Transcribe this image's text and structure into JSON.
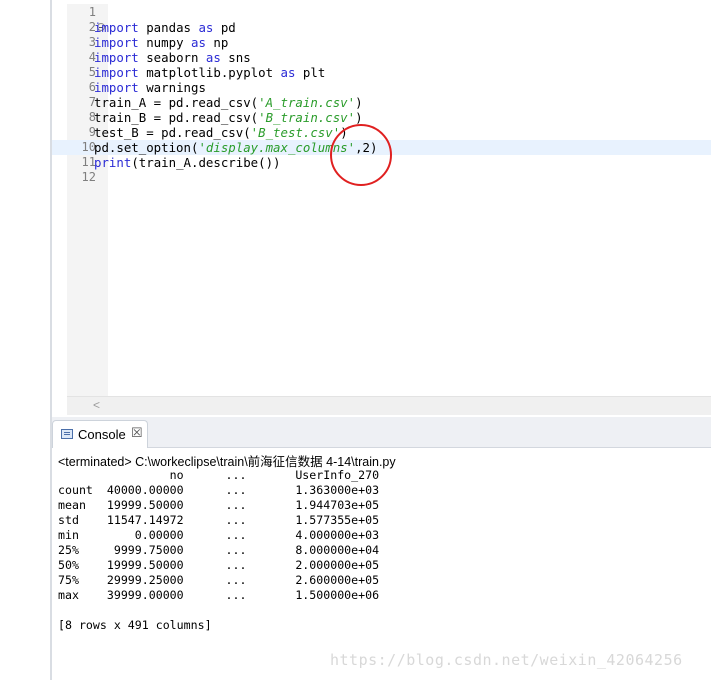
{
  "editor": {
    "lines": [
      {
        "n": "1",
        "tokens": []
      },
      {
        "n": "2",
        "fold": true,
        "tokens": [
          {
            "t": "import",
            "c": "kw"
          },
          {
            "t": " pandas "
          },
          {
            "t": "as",
            "c": "kw"
          },
          {
            "t": " pd"
          }
        ]
      },
      {
        "n": "3",
        "tokens": [
          {
            "t": "import",
            "c": "kw"
          },
          {
            "t": " numpy "
          },
          {
            "t": "as",
            "c": "kw"
          },
          {
            "t": " np"
          }
        ]
      },
      {
        "n": "4",
        "tokens": [
          {
            "t": "import",
            "c": "kw"
          },
          {
            "t": " seaborn "
          },
          {
            "t": "as",
            "c": "kw"
          },
          {
            "t": " sns"
          }
        ]
      },
      {
        "n": "5",
        "tokens": [
          {
            "t": "import",
            "c": "kw"
          },
          {
            "t": " matplotlib.pyplot "
          },
          {
            "t": "as",
            "c": "kw"
          },
          {
            "t": " plt"
          }
        ]
      },
      {
        "n": "6",
        "tokens": [
          {
            "t": "import",
            "c": "kw"
          },
          {
            "t": " warnings"
          }
        ]
      },
      {
        "n": "7",
        "tokens": [
          {
            "t": "train_A = pd.read_csv("
          },
          {
            "t": "'A_train.csv'",
            "c": "str"
          },
          {
            "t": ")"
          }
        ]
      },
      {
        "n": "8",
        "tokens": [
          {
            "t": "train_B = pd.read_csv("
          },
          {
            "t": "'B_train.csv'",
            "c": "str"
          },
          {
            "t": ")"
          }
        ]
      },
      {
        "n": "9",
        "tokens": [
          {
            "t": "test_B = pd.read_csv("
          },
          {
            "t": "'B_test.csv'",
            "c": "str"
          },
          {
            "t": ")"
          }
        ]
      },
      {
        "n": "10",
        "current": true,
        "tokens": [
          {
            "t": "pd.set_option("
          },
          {
            "t": "'display.max_columns'",
            "c": "str"
          },
          {
            "t": ",2)"
          }
        ]
      },
      {
        "n": "11",
        "tokens": [
          {
            "t": "print",
            "c": "kw"
          },
          {
            "t": "(train_A.describe())"
          }
        ]
      },
      {
        "n": "12",
        "tokens": []
      }
    ],
    "scroll_left_glyph": "<"
  },
  "console": {
    "tab_label": "Console",
    "close_glyph": "☒",
    "status": "<terminated> C:\\workeclipse\\train\\前海征信数据 4-14\\train.py",
    "output": [
      "                no      ...       UserInfo_270",
      "count  40000.00000      ...       1.363000e+03",
      "mean   19999.50000      ...       1.944703e+05",
      "std    11547.14972      ...       1.577355e+05",
      "min        0.00000      ...       4.000000e+03",
      "25%     9999.75000      ...       8.000000e+04",
      "50%    19999.50000      ...       2.000000e+05",
      "75%    29999.25000      ...       2.600000e+05",
      "max    39999.00000      ...       1.500000e+06",
      "",
      "[8 rows x 491 columns]"
    ]
  },
  "watermark": "https://blog.csdn.net/weixin_42064256",
  "colors": {
    "keyword": "#2b2bd5",
    "string": "#2a9c2a",
    "annotation": "#e02020"
  }
}
